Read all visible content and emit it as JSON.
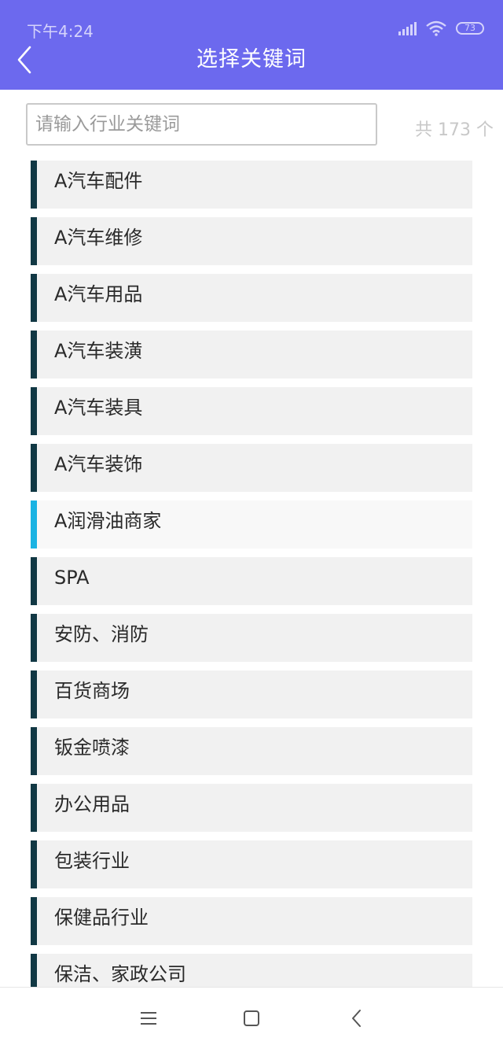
{
  "status_bar": {
    "time": "下午4:24",
    "battery": "73",
    "icons": [
      "signal-icon",
      "wifi-icon",
      "battery-icon"
    ]
  },
  "header": {
    "title": "选择关键词",
    "back_icon": "chevron-left-icon",
    "background": "#6c69ee"
  },
  "search": {
    "placeholder": "请输入行业关键词",
    "value": "",
    "count_text": "共 173 个"
  },
  "keywords": [
    {
      "label": "A汽车配件",
      "selected": false
    },
    {
      "label": "A汽车维修",
      "selected": false
    },
    {
      "label": "A汽车用品",
      "selected": false
    },
    {
      "label": "A汽车装潢",
      "selected": false
    },
    {
      "label": "A汽车装具",
      "selected": false
    },
    {
      "label": "A汽车装饰",
      "selected": false
    },
    {
      "label": "A润滑油商家",
      "selected": true
    },
    {
      "label": "SPA",
      "selected": false
    },
    {
      "label": "安防、消防",
      "selected": false
    },
    {
      "label": "百货商场",
      "selected": false
    },
    {
      "label": "钣金喷漆",
      "selected": false
    },
    {
      "label": "办公用品",
      "selected": false
    },
    {
      "label": "包装行业",
      "selected": false
    },
    {
      "label": "保健品行业",
      "selected": false
    },
    {
      "label": "保洁、家政公司",
      "selected": false
    }
  ],
  "colors": {
    "accent": "#6c69ee",
    "item_bar": "#113844",
    "item_bar_selected": "#1ab3e3",
    "item_bg": "#f1f1f1"
  },
  "nav_bar": {
    "icons": [
      "menu-icon",
      "home-square-icon",
      "back-chevron-icon"
    ]
  }
}
